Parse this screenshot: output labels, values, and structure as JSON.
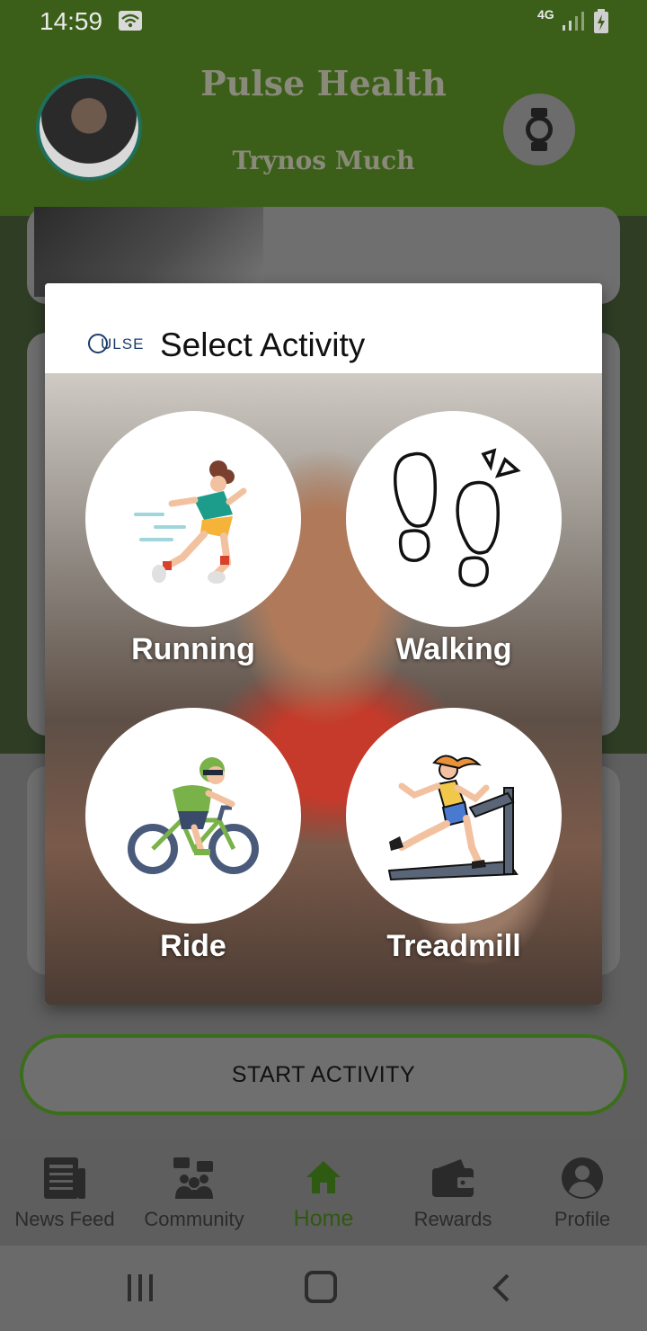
{
  "status_bar": {
    "time": "14:59",
    "network": "4G"
  },
  "header": {
    "app_title": "Pulse Health",
    "user_name": "Trynos Much"
  },
  "main": {
    "start_button_label": "START ACTIVITY"
  },
  "dialog": {
    "logo_text": "ULSE",
    "title": "Select Activity",
    "activities": [
      {
        "label": "Running",
        "icon": "running-person-icon"
      },
      {
        "label": "Walking",
        "icon": "footprints-icon"
      },
      {
        "label": "Ride",
        "icon": "cyclist-icon"
      },
      {
        "label": "Treadmill",
        "icon": "treadmill-icon"
      }
    ]
  },
  "bottom_nav": {
    "items": [
      {
        "label": "News Feed",
        "icon": "newspaper-icon"
      },
      {
        "label": "Community",
        "icon": "community-icon"
      },
      {
        "label": "Home",
        "icon": "home-icon",
        "active": true
      },
      {
        "label": "Rewards",
        "icon": "wallet-icon"
      },
      {
        "label": "Profile",
        "icon": "profile-icon"
      }
    ]
  },
  "colors": {
    "brand_green": "#3b5f18",
    "active_nav": "#2f5a12",
    "button_border": "#3b6e1b"
  }
}
